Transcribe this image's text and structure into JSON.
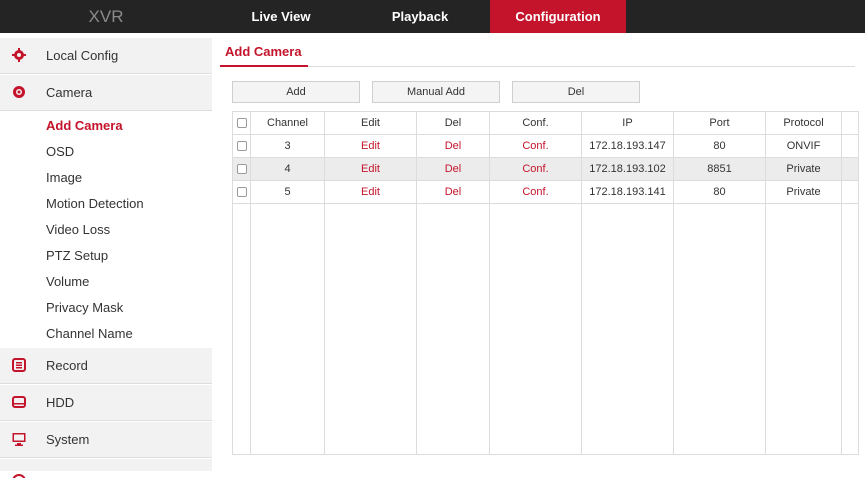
{
  "app": {
    "logo": "XVR"
  },
  "nav": {
    "tabs": [
      {
        "label": "Live View"
      },
      {
        "label": "Playback"
      },
      {
        "label": "Configuration"
      }
    ]
  },
  "sidebar": {
    "items": [
      {
        "label": "Local Config"
      },
      {
        "label": "Camera"
      },
      {
        "label": "Record"
      },
      {
        "label": "HDD"
      },
      {
        "label": "System"
      }
    ],
    "camera_subitems": [
      {
        "label": "Add Camera"
      },
      {
        "label": "OSD"
      },
      {
        "label": "Image"
      },
      {
        "label": "Motion Detection"
      },
      {
        "label": "Video Loss"
      },
      {
        "label": "PTZ Setup"
      },
      {
        "label": "Volume"
      },
      {
        "label": "Privacy Mask"
      },
      {
        "label": "Channel Name"
      }
    ]
  },
  "main": {
    "title": "Add Camera",
    "buttons": {
      "add": "Add",
      "manual_add": "Manual Add",
      "del": "Del"
    },
    "table": {
      "columns": [
        "Channel",
        "Edit",
        "Del",
        "Conf.",
        "IP",
        "Port",
        "Protocol"
      ],
      "rows": [
        {
          "channel": "3",
          "edit": "Edit",
          "del": "Del",
          "conf": "Conf.",
          "ip": "172.18.193.147",
          "port": "80",
          "protocol": "ONVIF"
        },
        {
          "channel": "4",
          "edit": "Edit",
          "del": "Del",
          "conf": "Conf.",
          "ip": "172.18.193.102",
          "port": "8851",
          "protocol": "Private"
        },
        {
          "channel": "5",
          "edit": "Edit",
          "del": "Del",
          "conf": "Conf.",
          "ip": "172.18.193.141",
          "port": "80",
          "protocol": "Private"
        }
      ]
    }
  },
  "colors": {
    "accent": "#c4142b",
    "topbar": "#242424",
    "sidebar_bg": "#f2f2f2"
  }
}
